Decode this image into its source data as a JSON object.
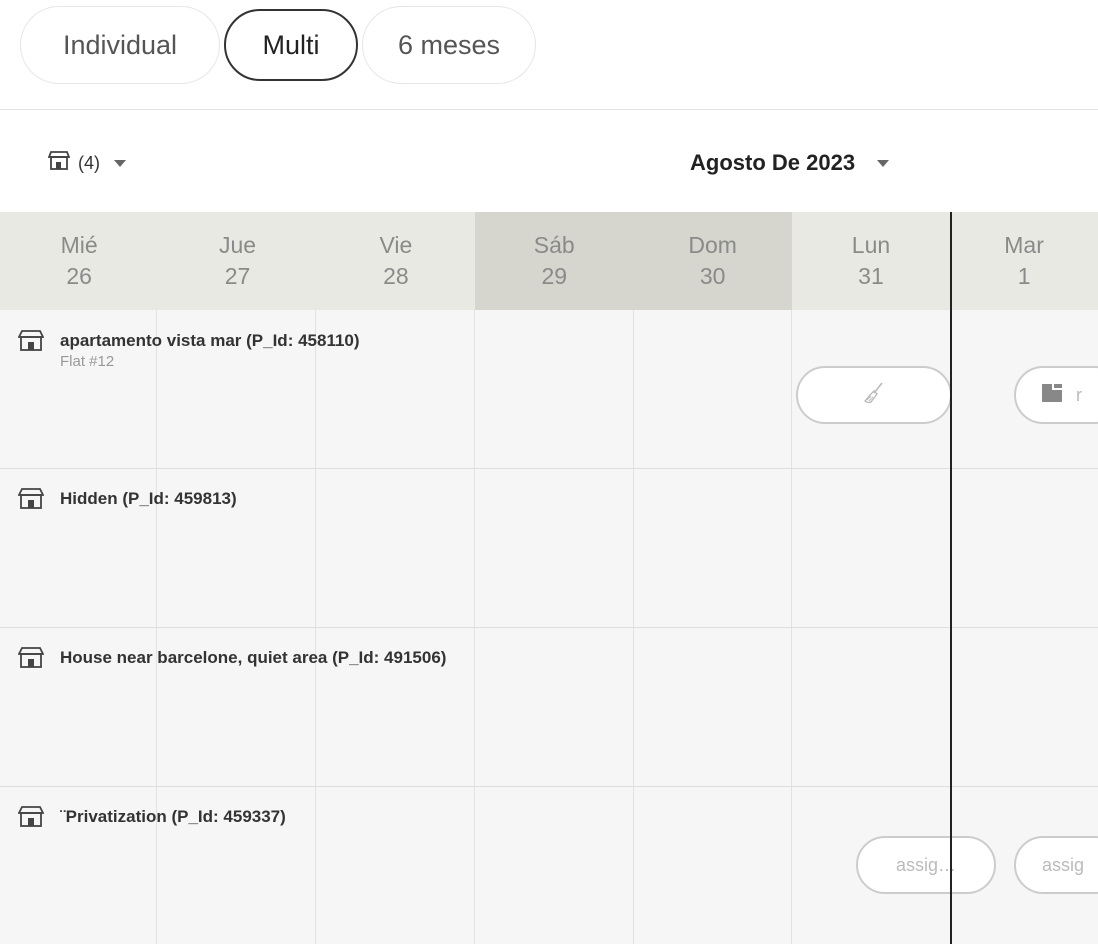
{
  "view_tabs": {
    "individual": "Individual",
    "multi": "Multi",
    "six_months": "6 meses"
  },
  "toolbar": {
    "property_count": "(4)",
    "month_label": "Agosto De 2023"
  },
  "days": [
    {
      "dow": "Mié",
      "date": "26"
    },
    {
      "dow": "Jue",
      "date": "27"
    },
    {
      "dow": "Vie",
      "date": "28"
    },
    {
      "dow": "Sáb",
      "date": "29"
    },
    {
      "dow": "Dom",
      "date": "30"
    },
    {
      "dow": "Lun",
      "date": "31"
    },
    {
      "dow": "Mar",
      "date": "1"
    }
  ],
  "properties": [
    {
      "name": "apartamento vista mar (P_Id: 458110)",
      "sub": "Flat #12"
    },
    {
      "name": "Hidden (P_Id: 459813)",
      "sub": ""
    },
    {
      "name": "House near barcelone, quiet area (P_Id: 491506)",
      "sub": ""
    },
    {
      "name": "¨Privatization (P_Id: 459337)",
      "sub": ""
    }
  ],
  "events": {
    "cleaning_label": "",
    "partial_label": "r",
    "assign_1": "assig…",
    "assign_2": "assig"
  },
  "colors": {
    "header_bg": "#e9e9e3",
    "weekend_bg": "#d6d6cf",
    "today_line": "#222222"
  }
}
